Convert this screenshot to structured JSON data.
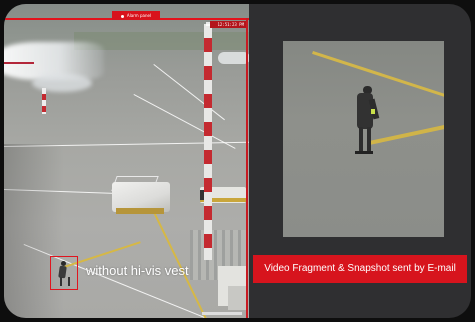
{
  "camera": {
    "panel_tab": "Alarm panel",
    "clock": "12:51:23 PM",
    "overlay_label": "without hi-vis vest"
  },
  "snapshot": {
    "notice": "Video Fragment & Snapshot sent by E-mail"
  },
  "colors": {
    "alert_red": "#d7141d",
    "panel_bg": "#2f2f31",
    "taxi_line_yellow": "#d2b64a"
  }
}
